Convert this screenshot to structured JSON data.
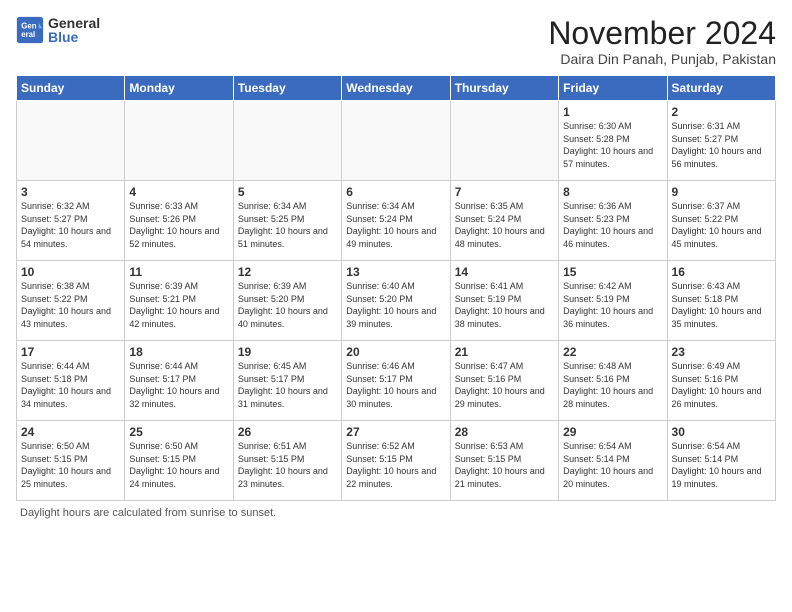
{
  "logo": {
    "general": "General",
    "blue": "Blue"
  },
  "header": {
    "month": "November 2024",
    "location": "Daira Din Panah, Punjab, Pakistan"
  },
  "weekdays": [
    "Sunday",
    "Monday",
    "Tuesday",
    "Wednesday",
    "Thursday",
    "Friday",
    "Saturday"
  ],
  "weeks": [
    [
      {
        "day": "",
        "info": ""
      },
      {
        "day": "",
        "info": ""
      },
      {
        "day": "",
        "info": ""
      },
      {
        "day": "",
        "info": ""
      },
      {
        "day": "",
        "info": ""
      },
      {
        "day": "1",
        "info": "Sunrise: 6:30 AM\nSunset: 5:28 PM\nDaylight: 10 hours and 57 minutes."
      },
      {
        "day": "2",
        "info": "Sunrise: 6:31 AM\nSunset: 5:27 PM\nDaylight: 10 hours and 56 minutes."
      }
    ],
    [
      {
        "day": "3",
        "info": "Sunrise: 6:32 AM\nSunset: 5:27 PM\nDaylight: 10 hours and 54 minutes."
      },
      {
        "day": "4",
        "info": "Sunrise: 6:33 AM\nSunset: 5:26 PM\nDaylight: 10 hours and 52 minutes."
      },
      {
        "day": "5",
        "info": "Sunrise: 6:34 AM\nSunset: 5:25 PM\nDaylight: 10 hours and 51 minutes."
      },
      {
        "day": "6",
        "info": "Sunrise: 6:34 AM\nSunset: 5:24 PM\nDaylight: 10 hours and 49 minutes."
      },
      {
        "day": "7",
        "info": "Sunrise: 6:35 AM\nSunset: 5:24 PM\nDaylight: 10 hours and 48 minutes."
      },
      {
        "day": "8",
        "info": "Sunrise: 6:36 AM\nSunset: 5:23 PM\nDaylight: 10 hours and 46 minutes."
      },
      {
        "day": "9",
        "info": "Sunrise: 6:37 AM\nSunset: 5:22 PM\nDaylight: 10 hours and 45 minutes."
      }
    ],
    [
      {
        "day": "10",
        "info": "Sunrise: 6:38 AM\nSunset: 5:22 PM\nDaylight: 10 hours and 43 minutes."
      },
      {
        "day": "11",
        "info": "Sunrise: 6:39 AM\nSunset: 5:21 PM\nDaylight: 10 hours and 42 minutes."
      },
      {
        "day": "12",
        "info": "Sunrise: 6:39 AM\nSunset: 5:20 PM\nDaylight: 10 hours and 40 minutes."
      },
      {
        "day": "13",
        "info": "Sunrise: 6:40 AM\nSunset: 5:20 PM\nDaylight: 10 hours and 39 minutes."
      },
      {
        "day": "14",
        "info": "Sunrise: 6:41 AM\nSunset: 5:19 PM\nDaylight: 10 hours and 38 minutes."
      },
      {
        "day": "15",
        "info": "Sunrise: 6:42 AM\nSunset: 5:19 PM\nDaylight: 10 hours and 36 minutes."
      },
      {
        "day": "16",
        "info": "Sunrise: 6:43 AM\nSunset: 5:18 PM\nDaylight: 10 hours and 35 minutes."
      }
    ],
    [
      {
        "day": "17",
        "info": "Sunrise: 6:44 AM\nSunset: 5:18 PM\nDaylight: 10 hours and 34 minutes."
      },
      {
        "day": "18",
        "info": "Sunrise: 6:44 AM\nSunset: 5:17 PM\nDaylight: 10 hours and 32 minutes."
      },
      {
        "day": "19",
        "info": "Sunrise: 6:45 AM\nSunset: 5:17 PM\nDaylight: 10 hours and 31 minutes."
      },
      {
        "day": "20",
        "info": "Sunrise: 6:46 AM\nSunset: 5:17 PM\nDaylight: 10 hours and 30 minutes."
      },
      {
        "day": "21",
        "info": "Sunrise: 6:47 AM\nSunset: 5:16 PM\nDaylight: 10 hours and 29 minutes."
      },
      {
        "day": "22",
        "info": "Sunrise: 6:48 AM\nSunset: 5:16 PM\nDaylight: 10 hours and 28 minutes."
      },
      {
        "day": "23",
        "info": "Sunrise: 6:49 AM\nSunset: 5:16 PM\nDaylight: 10 hours and 26 minutes."
      }
    ],
    [
      {
        "day": "24",
        "info": "Sunrise: 6:50 AM\nSunset: 5:15 PM\nDaylight: 10 hours and 25 minutes."
      },
      {
        "day": "25",
        "info": "Sunrise: 6:50 AM\nSunset: 5:15 PM\nDaylight: 10 hours and 24 minutes."
      },
      {
        "day": "26",
        "info": "Sunrise: 6:51 AM\nSunset: 5:15 PM\nDaylight: 10 hours and 23 minutes."
      },
      {
        "day": "27",
        "info": "Sunrise: 6:52 AM\nSunset: 5:15 PM\nDaylight: 10 hours and 22 minutes."
      },
      {
        "day": "28",
        "info": "Sunrise: 6:53 AM\nSunset: 5:15 PM\nDaylight: 10 hours and 21 minutes."
      },
      {
        "day": "29",
        "info": "Sunrise: 6:54 AM\nSunset: 5:14 PM\nDaylight: 10 hours and 20 minutes."
      },
      {
        "day": "30",
        "info": "Sunrise: 6:54 AM\nSunset: 5:14 PM\nDaylight: 10 hours and 19 minutes."
      }
    ]
  ],
  "footer": {
    "note": "Daylight hours are calculated from sunrise to sunset."
  }
}
